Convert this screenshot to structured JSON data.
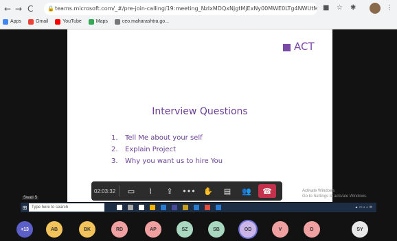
{
  "browser": {
    "back": "←",
    "forward": "→",
    "reload": "C",
    "url": "teams.microsoft.com/_#/pre-join-calling/19:meeting_NzIxMDQxNjgtMjExNy00MWE0LTg4NWUtMzU5MDYxNT...",
    "bookmarks": [
      {
        "label": "Apps",
        "color": "#4285f4"
      },
      {
        "label": "Gmail",
        "color": "#ea4335"
      },
      {
        "label": "YouTube",
        "color": "#ff0000"
      },
      {
        "label": "Maps",
        "color": "#34a853"
      },
      {
        "label": "ceo.maharashtra.go...",
        "color": "#777777"
      }
    ]
  },
  "slide": {
    "brand": "ACT",
    "title": "Interview Questions",
    "questions": [
      {
        "num": "1.",
        "text": "Tell Me about your self"
      },
      {
        "num": "2.",
        "text": "Explain Project"
      },
      {
        "num": "3.",
        "text": "Why you want us to hire You"
      }
    ]
  },
  "toolbar": {
    "time": "02:03:32",
    "icons": {
      "video": "▭",
      "mic": "⌇",
      "share": "⇪",
      "more": "•••",
      "hand": "✋",
      "chat": "▤",
      "people": "👥",
      "hangup": "☎"
    }
  },
  "watermark": {
    "line1": "Activate Windows",
    "line2": "Go to Settings to activate Windows."
  },
  "taskbar": {
    "search": "Type here to search",
    "presenter": "Swati S"
  },
  "participants": [
    {
      "initials": "+13",
      "color": "#5b5fc7",
      "text": "#ffffff"
    },
    {
      "initials": "AB",
      "color": "#f2c25b",
      "text": "#333333"
    },
    {
      "initials": "BK",
      "color": "#f2c25b",
      "text": "#333333"
    },
    {
      "initials": "RD",
      "color": "#f0a0a0",
      "text": "#333333"
    },
    {
      "initials": "AP",
      "color": "#f0a0a0",
      "text": "#333333"
    },
    {
      "initials": "SZ",
      "color": "#a8d8c0",
      "text": "#333333"
    },
    {
      "initials": "SB",
      "color": "#a8d8c0",
      "text": "#333333"
    },
    {
      "initials": "OD",
      "color": "#c9b5e8",
      "text": "#333333"
    },
    {
      "initials": "V",
      "color": "#f0a0a0",
      "text": "#333333"
    },
    {
      "initials": "D",
      "color": "#f0a0a0",
      "text": "#333333"
    },
    {
      "initials": "SY",
      "color": "#e8e8e8",
      "text": "#333333"
    }
  ]
}
